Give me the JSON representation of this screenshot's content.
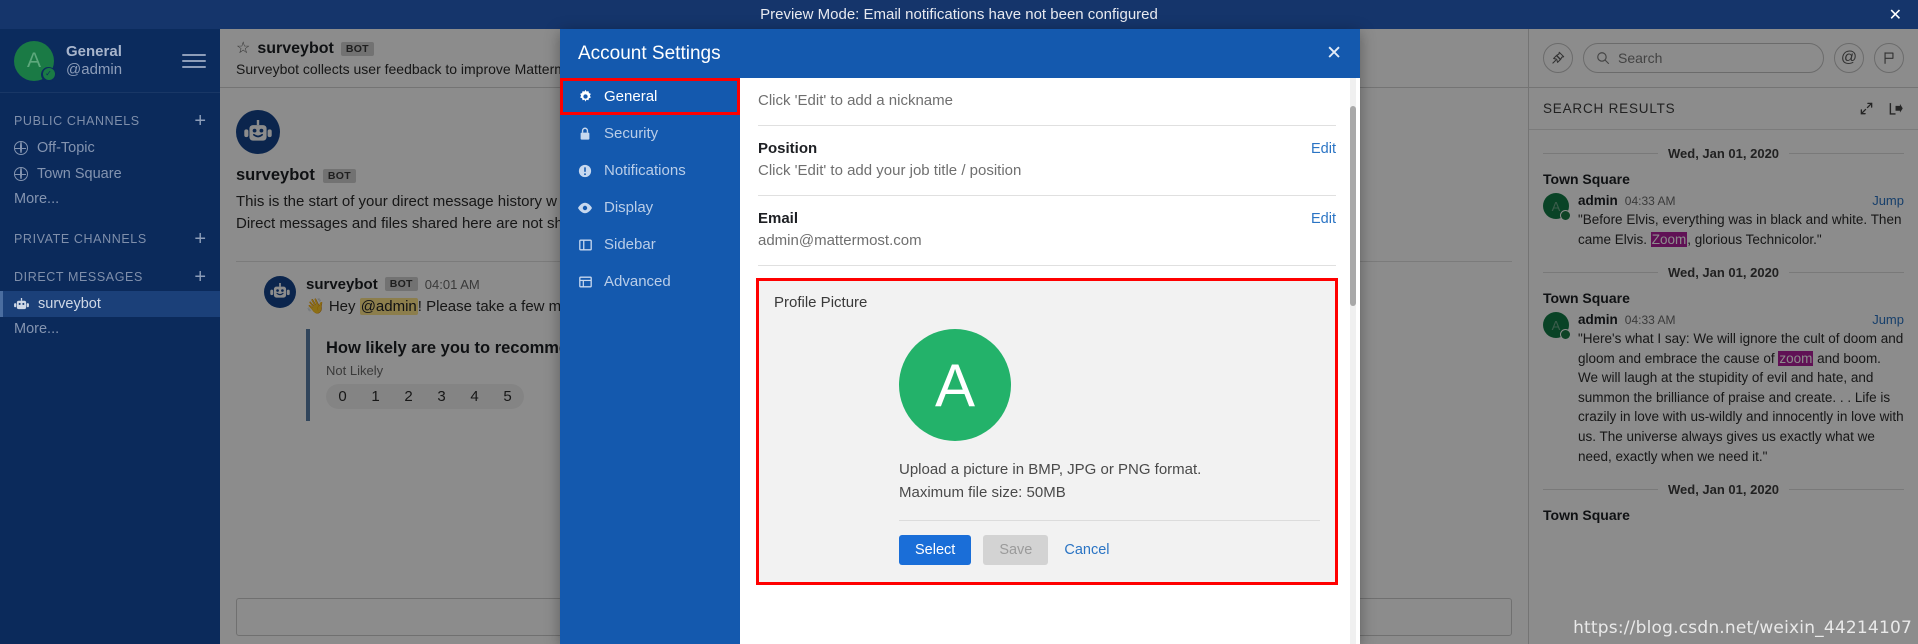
{
  "announcement": {
    "text": "Preview Mode: Email notifications have not been configured",
    "close_label": "✕"
  },
  "sidebar": {
    "team_name": "General",
    "user_handle": "@admin",
    "avatar_letter": "A",
    "status_check": "✓",
    "sections": [
      {
        "label": "PUBLIC CHANNELS",
        "plus": "+",
        "items": [
          {
            "label": "Off-Topic",
            "icon": "globe-icon"
          },
          {
            "label": "Town Square",
            "icon": "globe-icon"
          }
        ],
        "more": "More..."
      },
      {
        "label": "PRIVATE CHANNELS",
        "plus": "+",
        "items": [],
        "more": ""
      },
      {
        "label": "DIRECT MESSAGES",
        "plus": "+",
        "items": [
          {
            "label": "surveybot",
            "icon": "bot-icon"
          }
        ],
        "more": "More..."
      }
    ]
  },
  "channel": {
    "name": "surveybot",
    "bot_tag": "BOT",
    "description": "Surveybot collects user feedback to improve Mattermost. I",
    "intro_name": "surveybot",
    "intro_bot_tag": "BOT",
    "intro_line1": "This is the start of your direct message history w",
    "intro_line2": "Direct messages and files shared here are not sh",
    "post": {
      "user": "surveybot",
      "bot_tag": "BOT",
      "time": "04:01 AM",
      "text_pre": "👋 Hey ",
      "mention": "@admin",
      "text_post": "! Please take a few mo"
    },
    "survey": {
      "question": "How likely are you to recomme",
      "subtitle": "Not Likely",
      "options": [
        "0",
        "1",
        "2",
        "3",
        "4",
        "5"
      ]
    }
  },
  "rhs": {
    "search_placeholder": "Search",
    "title": "SEARCH RESULTS",
    "at_icon": "@",
    "flag_icon": "flag-icon",
    "pin_icon": "pin-icon",
    "expand_icon": "expand-icon",
    "close_icon": "close-sidebar-icon",
    "results": [
      {
        "date": "Wed, Jan 01, 2020",
        "channel": "Town Square",
        "user": "admin",
        "avatar_letter": "A",
        "time": "04:33 AM",
        "jump": "Jump",
        "segments": [
          {
            "text": "\"Before Elvis, everything was in black and white. Then came Elvis. ",
            "highlight": false
          },
          {
            "text": "Zoom",
            "highlight": true
          },
          {
            "text": ", glorious Technicolor.\"",
            "highlight": false
          }
        ]
      },
      {
        "date": "Wed, Jan 01, 2020",
        "channel": "Town Square",
        "user": "admin",
        "avatar_letter": "A",
        "time": "04:33 AM",
        "jump": "Jump",
        "segments": [
          {
            "text": "\"Here's what I say: We will ignore the cult of doom and gloom and embrace the cause of ",
            "highlight": false
          },
          {
            "text": "zoom",
            "highlight": true
          },
          {
            "text": " and boom. We will laugh at the stupidity of evil and hate, and summon the brilliance of praise and create. . . Life is crazily in love with us-wildly and innocently in love with us. The universe always gives us exactly what we need, exactly when we need it.\"",
            "highlight": false
          }
        ]
      }
    ],
    "trailing_date": "Wed, Jan 01, 2020",
    "trailing_channel": "Town Square"
  },
  "watermark": "https://blog.csdn.net/weixin_44214107",
  "modal": {
    "title": "Account Settings",
    "close_label": "✕",
    "nav": [
      {
        "label": "General",
        "icon": "gear-icon",
        "selected": true
      },
      {
        "label": "Security",
        "icon": "lock-icon",
        "selected": false
      },
      {
        "label": "Notifications",
        "icon": "bell-alert-icon",
        "selected": false
      },
      {
        "label": "Display",
        "icon": "eye-icon",
        "selected": false
      },
      {
        "label": "Sidebar",
        "icon": "sidebar-icon",
        "selected": false
      },
      {
        "label": "Advanced",
        "icon": "advanced-icon",
        "selected": false
      }
    ],
    "settings": {
      "nickname_value": "Click 'Edit' to add a nickname",
      "position_label": "Position",
      "position_edit": "Edit",
      "position_value": "Click 'Edit' to add your job title / position",
      "email_label": "Email",
      "email_edit": "Edit",
      "email_value": "admin@mattermost.com"
    },
    "profile_picture": {
      "label": "Profile Picture",
      "avatar_letter": "A",
      "avatar_color": "#23b26a",
      "help_line1": "Upload a picture in BMP, JPG or PNG format.",
      "help_line2": "Maximum file size: 50MB",
      "select_label": "Select",
      "save_label": "Save",
      "cancel_label": "Cancel"
    },
    "highlight_color": "#ff0000"
  }
}
